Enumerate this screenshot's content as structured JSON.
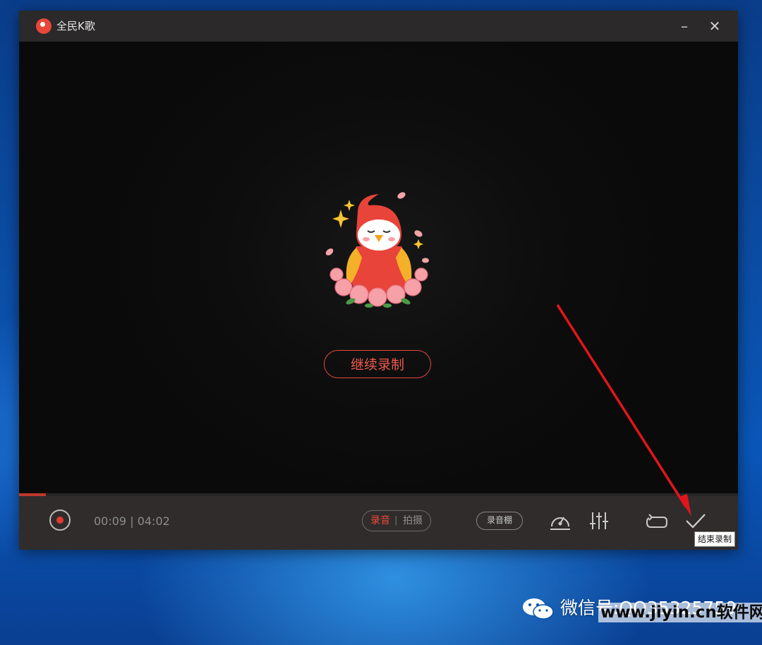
{
  "window": {
    "app_title": "全民K歌",
    "minimize_label": "–",
    "close_label": "✕"
  },
  "stage": {
    "continue_label": "继续录制"
  },
  "controls": {
    "progress_fraction": 0.0375,
    "time_current": "00:09",
    "time_separator": "|",
    "time_total": "04:02",
    "mode_audio_label": "录音",
    "mode_separator": "|",
    "mode_video_label": "拍摄",
    "studio_label": "录音棚",
    "finish_tooltip": "结束录制"
  },
  "watermark": {
    "wechat_text": "微信号:QQ35325759",
    "site_text": "www.jiyin.cn软件网"
  },
  "icons": {
    "logo": "quanmin-kge-logo-icon",
    "record": "record-dot-icon",
    "speedometer": "tuning-gauge-icon",
    "mixer": "equalizer-sliders-icon",
    "redo": "rerecord-loop-icon",
    "finish": "checkmark-icon",
    "wechat": "wechat-icon"
  },
  "colors": {
    "accent_red": "#e0493c",
    "titlebar": "#2b2929",
    "bottombar": "#302c2c",
    "stage": "#0b0b0b",
    "desktop_blue": "#0b4fa8"
  }
}
